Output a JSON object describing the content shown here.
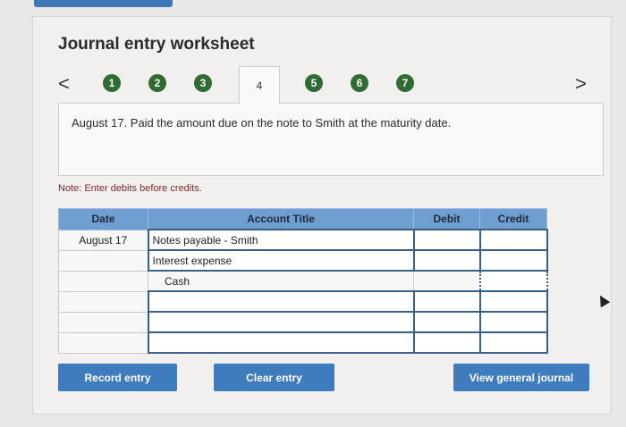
{
  "worksheet": {
    "title": "Journal entry worksheet",
    "prev_arrow": "<",
    "next_arrow": ">",
    "steps": [
      "1",
      "2",
      "3",
      "4",
      "5",
      "6",
      "7"
    ],
    "active_step": "4"
  },
  "transaction": {
    "description": "August 17. Paid the amount due on the note to Smith at the maturity date."
  },
  "note": "Note: Enter debits before credits.",
  "table": {
    "headers": {
      "date": "Date",
      "account": "Account Title",
      "debit": "Debit",
      "credit": "Credit"
    },
    "rows": [
      {
        "date": "August 17",
        "account": "Notes payable - Smith",
        "debit": "",
        "credit": ""
      },
      {
        "date": "",
        "account": "Interest expense",
        "debit": "",
        "credit": ""
      },
      {
        "date": "",
        "account": "Cash",
        "debit": "",
        "credit": ""
      },
      {
        "date": "",
        "account": "",
        "debit": "",
        "credit": ""
      },
      {
        "date": "",
        "account": "",
        "debit": "",
        "credit": ""
      },
      {
        "date": "",
        "account": "",
        "debit": "",
        "credit": ""
      }
    ]
  },
  "buttons": {
    "record": "Record entry",
    "clear": "Clear entry",
    "view": "View general journal"
  },
  "colors": {
    "step_green": "#2f6b33",
    "header_blue": "#6f9ed1",
    "button_blue": "#3e7cbd"
  }
}
